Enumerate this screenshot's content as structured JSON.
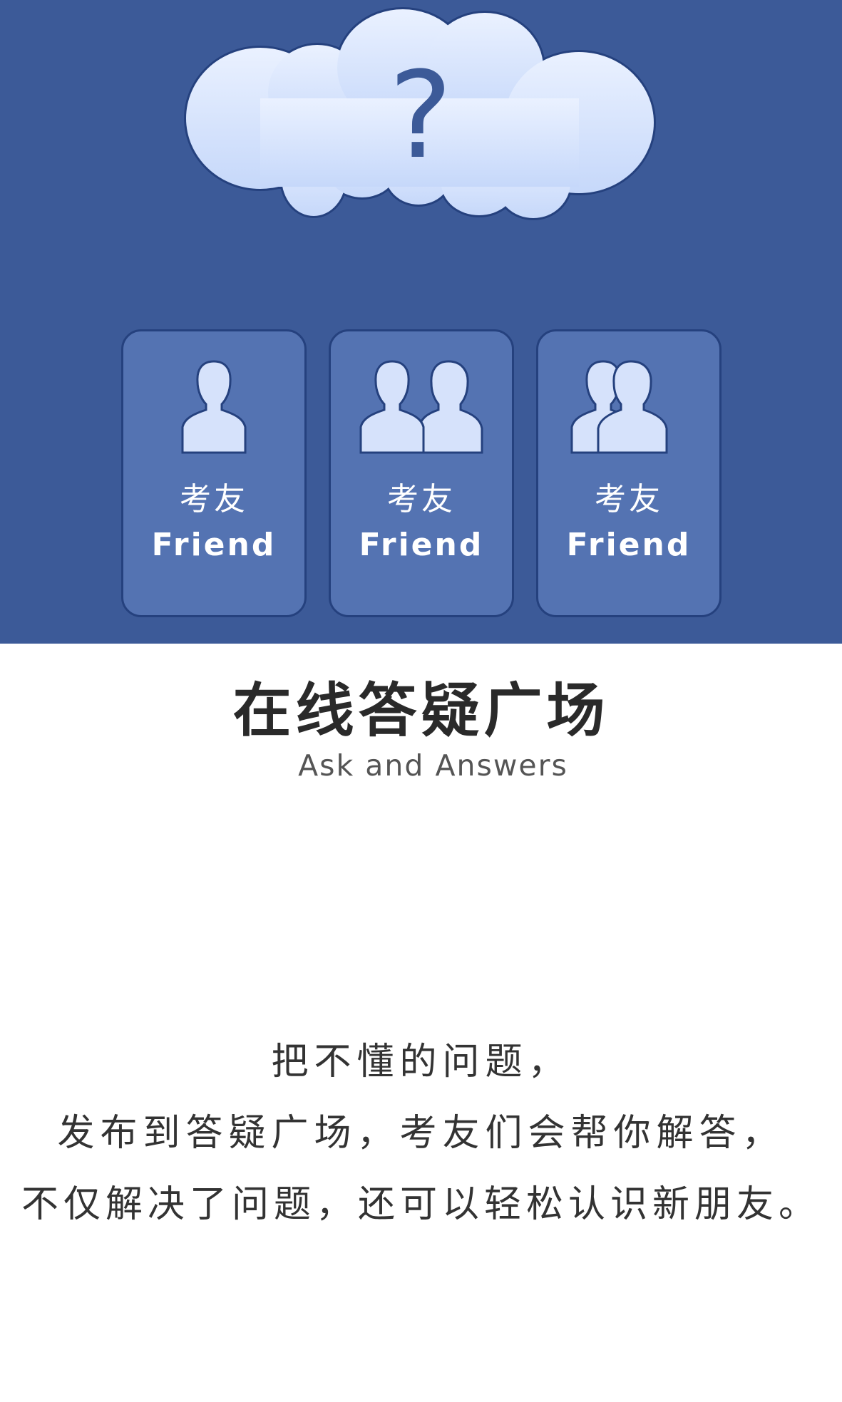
{
  "hero": {
    "question_mark": "?",
    "colors": {
      "background": "#3c5a98",
      "card": "#5473b2",
      "card_border": "#25417e",
      "icon_fill": "#d6e2fb",
      "cloud_top": "#eaf1ff",
      "cloud_bottom": "#c6d8fa"
    },
    "cards": [
      {
        "icon": "single-person-icon",
        "label_cn": "考友",
        "label_en": "Friend"
      },
      {
        "icon": "two-people-icon",
        "label_cn": "考友",
        "label_en": "Friend"
      },
      {
        "icon": "overlapping-people-icon",
        "label_cn": "考友",
        "label_en": "Friend"
      }
    ]
  },
  "section": {
    "title": "在线答疑广场",
    "subtitle": "Ask and Answers"
  },
  "description": {
    "lines": [
      "把不懂的问题，",
      "发布到答疑广场，考友们会帮你解答，",
      "不仅解决了问题，还可以轻松认识新朋友。"
    ]
  }
}
